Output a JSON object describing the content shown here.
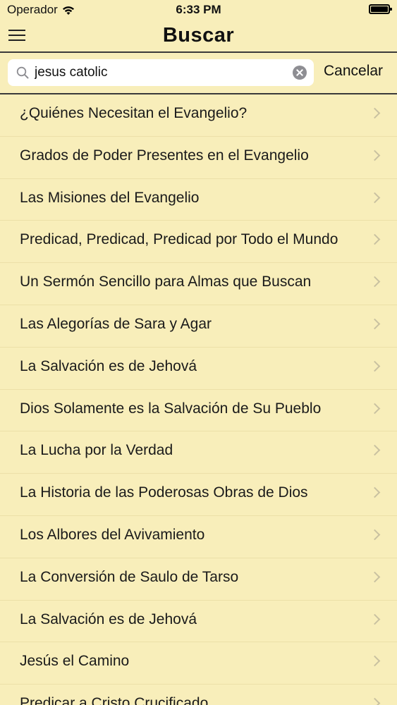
{
  "status_bar": {
    "carrier": "Operador",
    "time": "6:33 PM"
  },
  "nav": {
    "title": "Buscar"
  },
  "search": {
    "value": "jesus catolic",
    "cancel_label": "Cancelar"
  },
  "results": [
    "¿Quiénes Necesitan el Evangelio?",
    "Grados de Poder Presentes en el Evangelio",
    "Las Misiones del Evangelio",
    "Predicad, Predicad, Predicad por Todo el Mundo",
    "Un Sermón Sencillo para Almas que Buscan",
    "Las Alegorías de Sara y Agar",
    "La Salvación es de Jehová",
    "Dios Solamente es la Salvación de Su Pueblo",
    "La Lucha por la Verdad",
    "La Historia de las Poderosas Obras de Dios",
    "Los Albores del Avivamiento",
    "La Conversión de Saulo de Tarso",
    "La Salvación es de Jehová",
    "Jesús el Camino",
    "Predicar a Cristo Crucificado"
  ],
  "icons": {
    "menu": "hamburger-menu-icon",
    "wifi": "wifi-icon",
    "battery": "battery-icon",
    "search": "search-icon",
    "clear": "clear-icon",
    "row_chevron": "chevron-right-icon"
  },
  "colors": {
    "background": "#f8eeba",
    "separator": "#3a3a3a",
    "chevron": "#c9c1a0"
  }
}
